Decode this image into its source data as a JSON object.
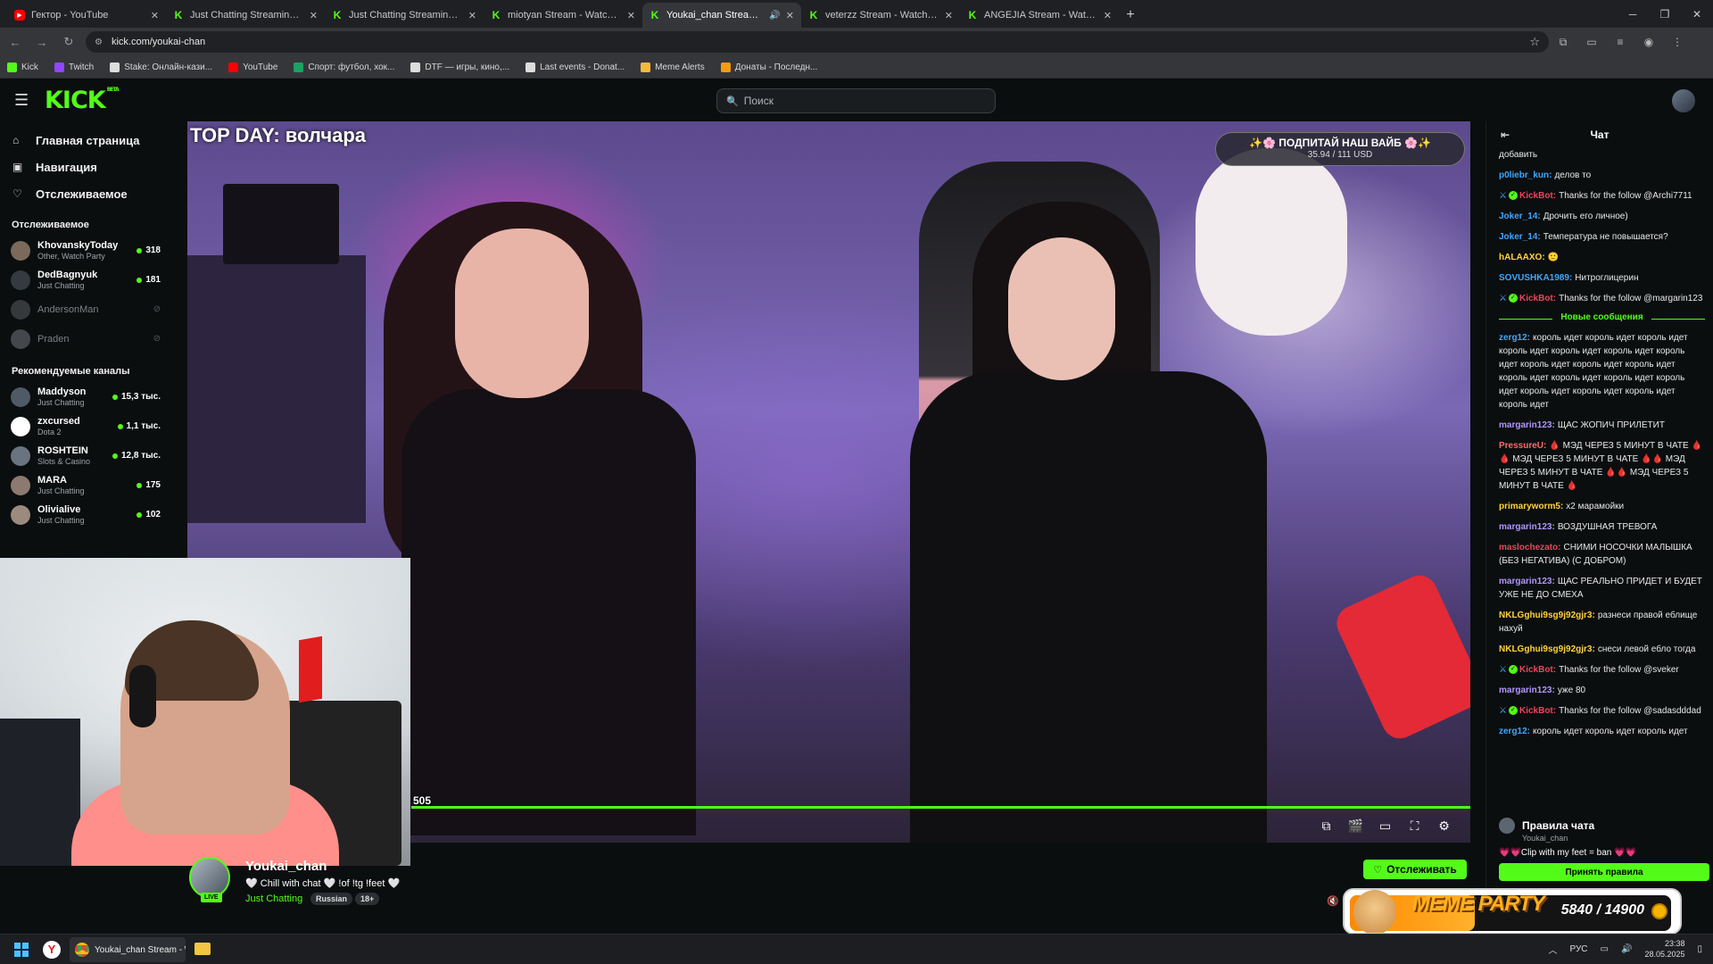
{
  "browser": {
    "tabs": [
      {
        "icon": "youtube",
        "title": "Гектор - YouTube",
        "active": false
      },
      {
        "icon": "kick",
        "title": "Just Chatting Streaming - Live S",
        "active": false
      },
      {
        "icon": "kick",
        "title": "Just Chatting Streaming - Live S",
        "active": false
      },
      {
        "icon": "kick",
        "title": "miotyan Stream - Watch Live on",
        "active": false
      },
      {
        "icon": "kick",
        "title": "Youkai_chan Stream - Watch",
        "active": true
      },
      {
        "icon": "kick",
        "title": "veterzz Stream - Watch Live on",
        "active": false
      },
      {
        "icon": "kick",
        "title": "ANGEJIA Stream - Watch Live o",
        "active": false
      }
    ],
    "url": "kick.com/youkai-chan",
    "bookmarks": [
      {
        "label": "Kick",
        "color": "#53fc18"
      },
      {
        "label": "Twitch",
        "color": "#9146ff"
      },
      {
        "label": "Stake: Онлайн-кази...",
        "color": "#dddddd"
      },
      {
        "label": "YouTube",
        "color": "#ff0000"
      },
      {
        "label": "Спорт: футбол, хок...",
        "color": "#1aa260"
      },
      {
        "label": "DTF — игры, кино,...",
        "color": "#dddddd"
      },
      {
        "label": "Last events - Donat...",
        "color": "#dddddd"
      },
      {
        "label": "Meme Alerts",
        "color": "#f6b93b"
      },
      {
        "label": "Донаты - Последн...",
        "color": "#f39c12"
      }
    ]
  },
  "header": {
    "logo": "KICK",
    "logo_sup": "BETA",
    "search_placeholder": "Поиск"
  },
  "sidebar": {
    "nav": [
      {
        "icon": "home-icon",
        "label": "Главная страница"
      },
      {
        "icon": "compass-icon",
        "label": "Навигация"
      },
      {
        "icon": "heart-icon",
        "label": "Отслеживаемое"
      }
    ],
    "following_heading": "Отслеживаемое",
    "following": [
      {
        "name": "KhovanskyToday",
        "category": "Other, Watch Party",
        "viewers": "318",
        "live": true,
        "color": "#7b6a5c"
      },
      {
        "name": "DedBagnyuk",
        "category": "Just Chatting",
        "viewers": "181",
        "live": true,
        "color": "#333a40"
      },
      {
        "name": "AndersonMan",
        "category": "",
        "viewers": "",
        "live": false,
        "color": "#6b6f74"
      },
      {
        "name": "Praden",
        "category": "",
        "viewers": "",
        "live": false,
        "color": "#8a8f94"
      }
    ],
    "recommended_heading": "Рекомендуемые каналы",
    "recommended": [
      {
        "name": "Maddyson",
        "category": "Just Chatting",
        "viewers": "15,3 тыс.",
        "color": "#4e5a66"
      },
      {
        "name": "zxcursed",
        "category": "Dota 2",
        "viewers": "1,1 тыс.",
        "color": "#ffffff"
      },
      {
        "name": "ROSHTEIN",
        "category": "Slots & Casino",
        "viewers": "12,8 тыс.",
        "color": "#6a7480"
      },
      {
        "name": "MARA",
        "category": "Just Chatting",
        "viewers": "175",
        "color": "#8c7a70"
      },
      {
        "name": "Olivialive",
        "category": "Just Chatting",
        "viewers": "102",
        "color": "#9c8a7e"
      }
    ]
  },
  "player": {
    "overlay_title": "TOP DAY: волчара",
    "goal_title": "✨🌸 ПОДПИТАЙ НАШ ВАЙБ 🌸✨",
    "goal_amount": "35.94 / 111 USD",
    "time_label": "505",
    "controls": [
      "pip-icon",
      "clip-icon",
      "theater-icon",
      "fullscreen-icon",
      "settings-icon"
    ]
  },
  "stream": {
    "name": "Youkai_chan",
    "title": "🤍 Chill with chat 🤍 !of !tg !feet 🤍",
    "category": "Just Chatting",
    "live_label": "LIVE",
    "tags": [
      "Russian",
      "18+"
    ],
    "follow_label": "Отслеживать"
  },
  "chat": {
    "title": "Чат",
    "messages_before": [
      {
        "user": "",
        "color": "#e8e8e8",
        "text": "добавить",
        "bot": false
      },
      {
        "user": "p0liebr_kun:",
        "color": "#3fa7ff",
        "text": "делов то",
        "bot": false
      },
      {
        "user": "KickBot:",
        "color": "#e9455a",
        "text": "Thanks for the follow @Archi7711",
        "bot": true
      },
      {
        "user": "Joker_14:",
        "color": "#3fa7ff",
        "text": "Дрочить его личное)",
        "bot": false
      },
      {
        "user": "Joker_14:",
        "color": "#3fa7ff",
        "text": "Температура не повышается?",
        "bot": false
      },
      {
        "user": "hALAAXO:",
        "color": "#ffd43b",
        "text": "🙂",
        "bot": false
      },
      {
        "user": "SOVUSHKA1989:",
        "color": "#3fa7ff",
        "text": "Нитроглицерин",
        "bot": false
      },
      {
        "user": "KickBot:",
        "color": "#e9455a",
        "text": "Thanks for the follow @margarin123",
        "bot": true
      }
    ],
    "new_messages_label": "Новые сообщения",
    "messages_after": [
      {
        "user": "zerg12:",
        "color": "#3fa7ff",
        "text": "король идет король идет король идет король идет король идет король идет король идет король идет король идет король идет король идет король идет король идет король идет король идет король идет король идет король идет",
        "bot": false
      },
      {
        "user": "margarin123:",
        "color": "#b197fc",
        "text": "ЩАС ЖОПИЧ ПРИЛЕТИТ",
        "bot": false
      },
      {
        "user": "PressureU:",
        "color": "#ff6b6b",
        "text": "🩸 МЭД ЧЕРЕЗ 5 МИНУТ В ЧАТЕ 🩸🩸 МЭД ЧЕРЕЗ 5 МИНУТ В ЧАТЕ 🩸🩸 МЭД ЧЕРЕЗ 5 МИНУТ В ЧАТЕ 🩸🩸 МЭД ЧЕРЕЗ 5 МИНУТ В ЧАТЕ 🩸",
        "bot": false
      },
      {
        "user": "primaryworm5:",
        "color": "#ffd43b",
        "text": "х2 марамойки",
        "bot": false
      },
      {
        "user": "margarin123:",
        "color": "#b197fc",
        "text": "ВОЗДУШНАЯ ТРЕВОГА",
        "bot": false
      },
      {
        "user": "maslochezato:",
        "color": "#e9455a",
        "text": "СНИМИ НОСОЧКИ МАЛЫШКА (БЕЗ НЕГАТИВА) (С ДОБРОМ)",
        "bot": false
      },
      {
        "user": "margarin123:",
        "color": "#b197fc",
        "text": "ЩАС РЕАЛЬНО ПРИДЕТ И БУДЕТ УЖЕ НЕ ДО СМЕХА",
        "bot": false
      },
      {
        "user": "NKLGghui9sg9j92gjr3:",
        "color": "#ffd43b",
        "text": "разнеси правой еблище нахуй",
        "bot": false
      },
      {
        "user": "NKLGghui9sg9j92gjr3:",
        "color": "#ffd43b",
        "text": "снеси левой ебло тогда",
        "bot": false
      },
      {
        "user": "KickBot:",
        "color": "#e9455a",
        "text": "Thanks for the follow @sveker",
        "bot": true
      },
      {
        "user": "margarin123:",
        "color": "#b197fc",
        "text": "уже 80",
        "bot": false
      },
      {
        "user": "KickBot:",
        "color": "#e9455a",
        "text": "Thanks for the follow @sadasdddad",
        "bot": true
      },
      {
        "user": "zerg12:",
        "color": "#3fa7ff",
        "text": "король идет король идет король идет",
        "bot": false
      }
    ],
    "rules_title": "Правила чата",
    "rules_channel": "Youkai_chan",
    "rules_text": "💗💗Clip with my feet = ban 💗💗",
    "accept_label": "Принять правила"
  },
  "meme_party": {
    "title": "MEME PARTY",
    "count": "5840 / 14900",
    "progress": 0.39
  },
  "taskbar": {
    "chrome_label": "Youkai_chan Stream - W",
    "lang": "РУС",
    "time": "23:38",
    "date": "28.05.2025"
  }
}
